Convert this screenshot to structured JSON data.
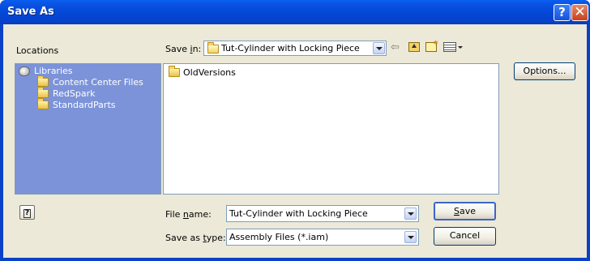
{
  "window": {
    "title": "Save As",
    "help_button": "?",
    "close_button": "✕"
  },
  "locations": {
    "header": "Locations",
    "items": [
      {
        "label": "Libraries",
        "icon": "library-icon"
      },
      {
        "label": "Content Center Files",
        "icon": "folder-icon"
      },
      {
        "label": "RedSpark",
        "icon": "folder-icon"
      },
      {
        "label": "StandardParts",
        "icon": "folder-icon"
      }
    ]
  },
  "save_in": {
    "label_pre": "Save ",
    "label_mnemonic": "i",
    "label_post": "n:",
    "value": "Tut-Cylinder with Locking Piece"
  },
  "toolbar": {
    "back_icon": "⇦",
    "up_folder_icon": "up-one-level-icon",
    "new_folder_icon": "new-folder-icon",
    "views_icon": "views-menu-icon"
  },
  "file_list": {
    "items": [
      {
        "name": "OldVersions",
        "icon": "folder-icon"
      }
    ]
  },
  "options_button": "Options...",
  "file_name": {
    "label_pre": "File ",
    "label_mnemonic": "n",
    "label_post": "ame:",
    "value": "Tut-Cylinder with Locking Piece"
  },
  "save_as_type": {
    "label_pre": "Save as ",
    "label_mnemonic": "t",
    "label_post": "ype:",
    "value": "Assembly Files (*.iam)"
  },
  "buttons": {
    "save_mnemonic": "S",
    "save_rest": "ave",
    "cancel": "Cancel"
  },
  "help_icon": "?"
}
